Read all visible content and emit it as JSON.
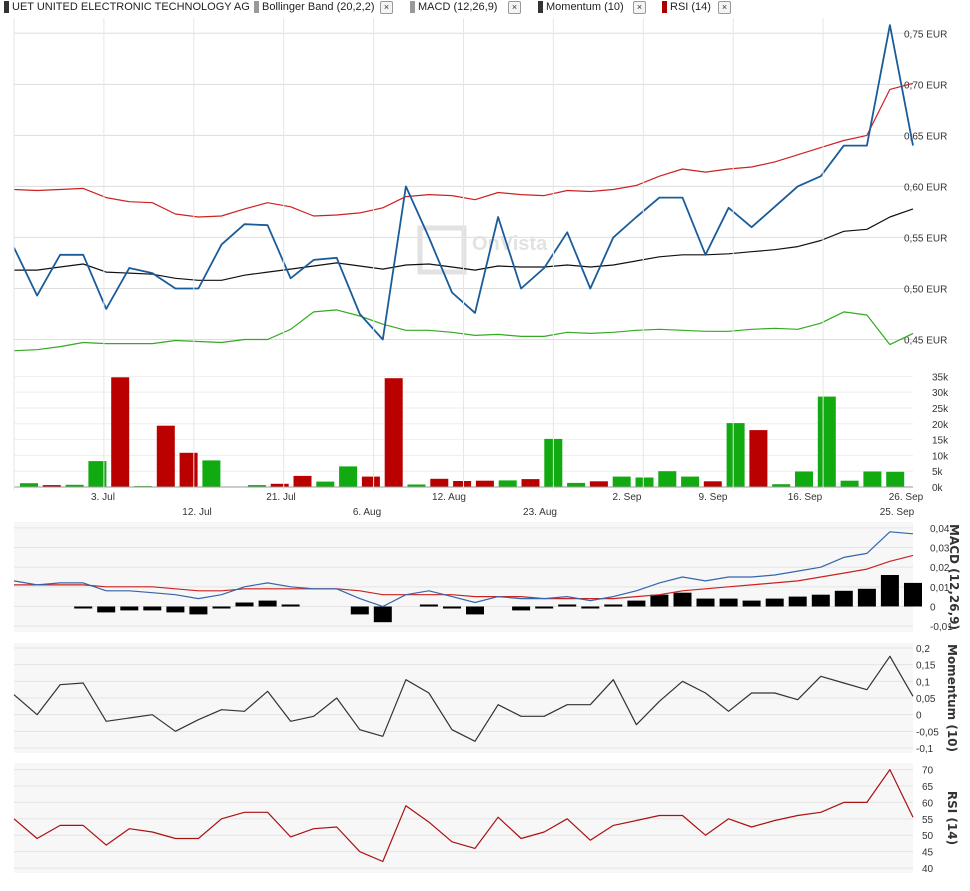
{
  "legend": {
    "instrument": "UET UNITED ELECTRONIC TECHNOLOGY AG",
    "bollinger": "Bollinger Band (20,2,2)",
    "macd": "MACD (12,26,9)",
    "momentum": "Momentum (10)",
    "rsi": "RSI (14)",
    "close_glyph": "×",
    "colors": {
      "instrument": "#333333",
      "bollinger": "#999999",
      "macd": "#999999",
      "momentum": "#333333",
      "rsi": "#aa0000"
    }
  },
  "watermark": "OnVista",
  "chart_data": [
    {
      "type": "line",
      "title": "",
      "y_ticks": [
        "0,45 EUR",
        "0,50 EUR",
        "0,55 EUR",
        "0,60 EUR",
        "0,65 EUR",
        "0,70 EUR",
        "0,75 EUR"
      ],
      "ylim": [
        0.425,
        0.765
      ],
      "x_labels_top": [
        "3. Jul",
        "21. Jul",
        "12. Aug",
        "2. Sep",
        "9. Sep",
        "16. Sep",
        "26. Sep"
      ],
      "x_labels_bottom": [
        "12. Jul",
        "6. Aug",
        "23. Aug",
        "25. Sep"
      ],
      "series": [
        {
          "name": "UET UNITED ELECTRONIC TECHNOLOGY AG",
          "color": "#1a5c9a",
          "values": [
            0.54,
            0.493,
            0.533,
            0.533,
            0.48,
            0.52,
            0.515,
            0.5,
            0.5,
            0.543,
            0.563,
            0.562,
            0.51,
            0.528,
            0.53,
            0.475,
            0.45,
            0.6,
            0.55,
            0.496,
            0.476,
            0.57,
            0.5,
            0.52,
            0.555,
            0.5,
            0.55,
            0.57,
            0.589,
            0.589,
            0.533,
            0.579,
            0.56,
            0.58,
            0.6,
            0.61,
            0.64,
            0.64,
            0.758,
            0.64
          ]
        },
        {
          "name": "",
          "color": "#111111",
          "values": [
            0.518,
            0.518,
            0.521,
            0.524,
            0.516,
            0.515,
            0.514,
            0.51,
            0.508,
            0.508,
            0.513,
            0.516,
            0.519,
            0.522,
            0.525,
            0.522,
            0.519,
            0.523,
            0.524,
            0.521,
            0.518,
            0.522,
            0.521,
            0.521,
            0.523,
            0.521,
            0.523,
            0.527,
            0.531,
            0.533,
            0.533,
            0.534,
            0.536,
            0.538,
            0.541,
            0.547,
            0.556,
            0.558,
            0.57,
            0.578
          ]
        },
        {
          "name": "",
          "color": "#cc2222",
          "values": [
            0.597,
            0.596,
            0.597,
            0.598,
            0.589,
            0.585,
            0.584,
            0.573,
            0.57,
            0.571,
            0.578,
            0.584,
            0.58,
            0.571,
            0.572,
            0.574,
            0.579,
            0.59,
            0.592,
            0.591,
            0.587,
            0.594,
            0.592,
            0.591,
            0.596,
            0.595,
            0.597,
            0.601,
            0.61,
            0.617,
            0.614,
            0.617,
            0.619,
            0.624,
            0.631,
            0.638,
            0.645,
            0.65,
            0.695,
            0.701
          ]
        },
        {
          "name": "",
          "color": "#33aa22",
          "values": [
            0.439,
            0.44,
            0.443,
            0.447,
            0.446,
            0.446,
            0.446,
            0.449,
            0.448,
            0.447,
            0.45,
            0.45,
            0.46,
            0.477,
            0.479,
            0.473,
            0.465,
            0.459,
            0.459,
            0.457,
            0.454,
            0.455,
            0.453,
            0.453,
            0.457,
            0.456,
            0.457,
            0.459,
            0.46,
            0.459,
            0.458,
            0.458,
            0.46,
            0.461,
            0.46,
            0.466,
            0.477,
            0.474,
            0.445,
            0.456
          ]
        }
      ]
    },
    {
      "type": "bar",
      "title": "",
      "y_ticks": [
        "0k",
        "5k",
        "10k",
        "15k",
        "20k",
        "25k",
        "30k",
        "35k"
      ],
      "ylim": [
        0,
        37000
      ],
      "up_color": "#11aa11",
      "down_color": "#bb0000",
      "values": [
        1200,
        600,
        700,
        8200,
        34700,
        300,
        19400,
        10800,
        8400,
        0,
        600,
        1000,
        3500,
        1700,
        6500,
        3300,
        34400,
        800,
        2600,
        1900,
        2000,
        2100,
        2500,
        15200,
        1300,
        1800,
        3300,
        3000,
        5000,
        3300,
        1800,
        20200,
        18000,
        900,
        4900,
        28600,
        2000,
        4900,
        4800
      ],
      "directions": [
        "up",
        "down",
        "up",
        "up",
        "down",
        "up",
        "down",
        "down",
        "up",
        "up",
        "up",
        "down",
        "down",
        "up",
        "up",
        "down",
        "down",
        "up",
        "down",
        "down",
        "down",
        "up",
        "down",
        "up",
        "up",
        "down",
        "up",
        "up",
        "up",
        "up",
        "down",
        "up",
        "down",
        "up",
        "up",
        "up",
        "up",
        "up",
        "up"
      ]
    },
    {
      "type": "line",
      "title": "",
      "ylabel": "MACD (12,26,9)",
      "y_ticks": [
        "-0,01",
        "0",
        "0,01",
        "0,02",
        "0,03",
        "0,04"
      ],
      "ylim": [
        -0.013,
        0.043
      ],
      "macd": [
        0.013,
        0.011,
        0.012,
        0.012,
        0.008,
        0.008,
        0.007,
        0.006,
        0.004,
        0.006,
        0.01,
        0.012,
        0.01,
        0.009,
        0.009,
        0.004,
        0.0,
        0.006,
        0.008,
        0.005,
        0.002,
        0.005,
        0.004,
        0.004,
        0.005,
        0.003,
        0.005,
        0.008,
        0.012,
        0.015,
        0.013,
        0.015,
        0.015,
        0.016,
        0.018,
        0.02,
        0.025,
        0.027,
        0.038,
        0.037
      ],
      "signal": [
        0.011,
        0.011,
        0.011,
        0.011,
        0.01,
        0.01,
        0.01,
        0.009,
        0.008,
        0.008,
        0.009,
        0.009,
        0.009,
        0.009,
        0.009,
        0.008,
        0.006,
        0.006,
        0.006,
        0.006,
        0.005,
        0.005,
        0.005,
        0.004,
        0.004,
        0.004,
        0.004,
        0.005,
        0.006,
        0.008,
        0.009,
        0.01,
        0.011,
        0.012,
        0.013,
        0.015,
        0.017,
        0.019,
        0.023,
        0.026
      ],
      "histogram": [
        null,
        null,
        null,
        -0.001,
        -0.003,
        -0.002,
        -0.002,
        -0.003,
        -0.004,
        -0.001,
        0.002,
        0.003,
        0.001,
        null,
        null,
        -0.004,
        -0.008,
        null,
        0.001,
        -0.001,
        -0.004,
        null,
        -0.002,
        -0.001,
        0.001,
        -0.001,
        0.001,
        0.003,
        0.006,
        0.007,
        0.004,
        0.004,
        0.003,
        0.004,
        0.005,
        0.006,
        0.008,
        0.009,
        0.016,
        0.012
      ],
      "colors": {
        "macd": "#3366aa",
        "signal": "#cc2222",
        "histogram": "#000000"
      }
    },
    {
      "type": "line",
      "title": "",
      "ylabel": "Momentum (10)",
      "y_ticks": [
        "-0,1",
        "-0,05",
        "0",
        "0,05",
        "0,1",
        "0,15",
        "0,2"
      ],
      "ylim": [
        -0.115,
        0.215
      ],
      "values": [
        0.06,
        0.0,
        0.09,
        0.095,
        -0.02,
        -0.01,
        0.0,
        -0.05,
        -0.015,
        0.015,
        0.01,
        0.07,
        -0.02,
        -0.005,
        0.05,
        -0.045,
        -0.065,
        0.105,
        0.065,
        -0.045,
        -0.08,
        0.03,
        -0.005,
        -0.005,
        0.03,
        0.03,
        0.105,
        -0.03,
        0.04,
        0.1,
        0.065,
        0.01,
        0.065,
        0.065,
        0.045,
        0.115,
        0.095,
        0.075,
        0.175,
        0.055
      ],
      "color": "#333333"
    },
    {
      "type": "line",
      "title": "",
      "ylabel": "RSI (14)",
      "y_ticks": [
        "40",
        "45",
        "50",
        "55",
        "60",
        "65",
        "70"
      ],
      "ylim": [
        38.5,
        72
      ],
      "values": [
        55,
        49,
        53,
        53,
        47,
        52,
        51,
        49,
        49,
        55,
        57,
        57,
        49.5,
        52,
        52.5,
        45,
        42,
        59,
        54,
        48,
        46,
        55.5,
        49,
        51,
        55,
        48.5,
        53,
        54.5,
        56,
        56,
        50,
        55,
        52.5,
        54.5,
        56,
        57,
        60,
        60,
        70,
        55.5
      ],
      "color": "#aa1111"
    }
  ]
}
